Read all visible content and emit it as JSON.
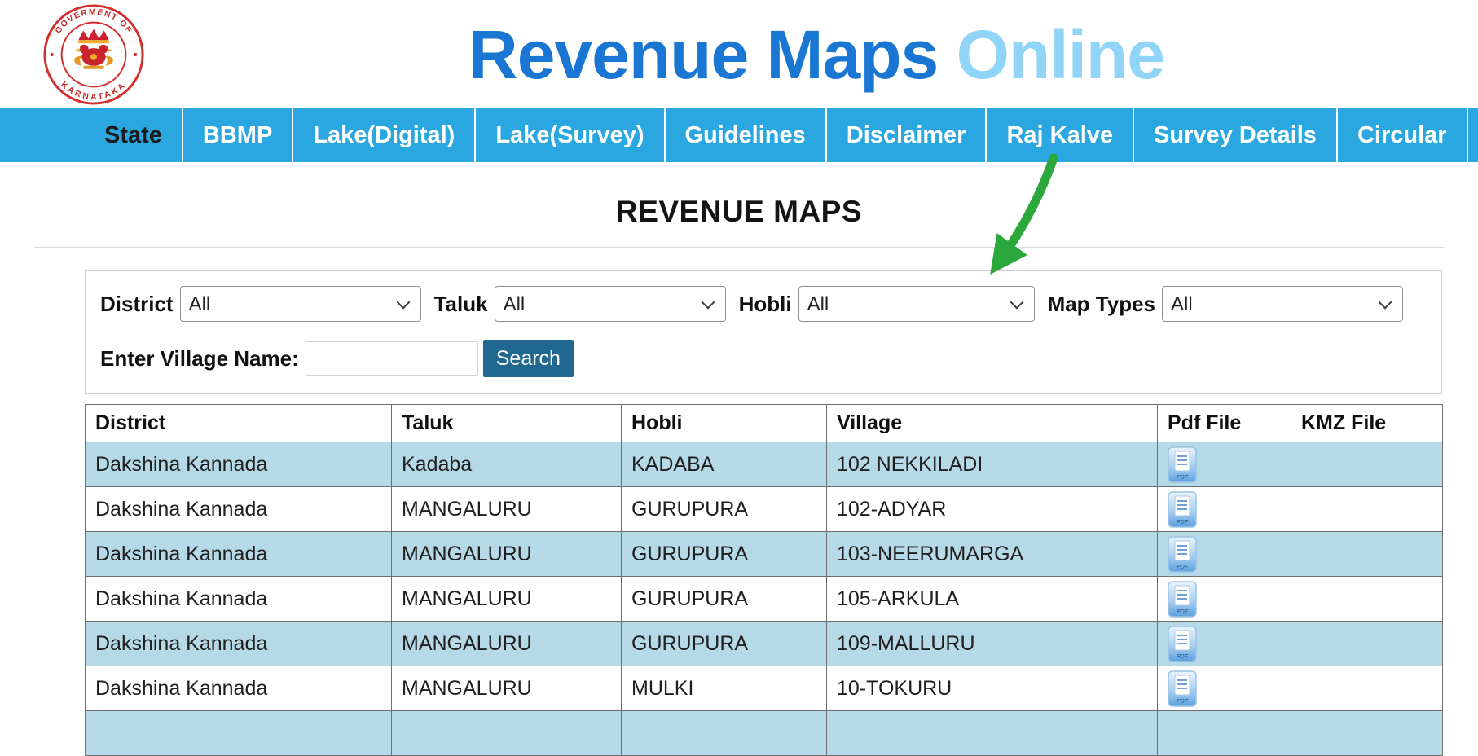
{
  "colors": {
    "nav_bg": "#2aa7e0",
    "title_primary": "#1976d2",
    "title_secondary": "#90d5f7",
    "row_stripe": "#b6d9e7",
    "search_button": "#20688f",
    "annotation_arrow": "#2ba83c"
  },
  "logo": {
    "top_text": "GOVERMENT OF",
    "bottom_text": "KARNATAKA"
  },
  "header": {
    "title_primary": "Revenue Maps",
    "title_secondary": "Online"
  },
  "nav": {
    "items": [
      {
        "label": "State",
        "active": true
      },
      {
        "label": "BBMP"
      },
      {
        "label": "Lake(Digital)"
      },
      {
        "label": "Lake(Survey)"
      },
      {
        "label": "Guidelines"
      },
      {
        "label": "Disclaimer"
      },
      {
        "label": "Raj Kalve"
      },
      {
        "label": "Survey Details"
      },
      {
        "label": "Circular"
      }
    ]
  },
  "page": {
    "heading": "REVENUE MAPS"
  },
  "filters": {
    "district_label": "District",
    "district_value": "All",
    "taluk_label": "Taluk",
    "taluk_value": "All",
    "hobli_label": "Hobli",
    "hobli_value": "All",
    "map_types_label": "Map Types",
    "map_types_value": "All",
    "village_label": "Enter Village Name:",
    "village_value": "",
    "search_label": "Search"
  },
  "table": {
    "columns": [
      "District",
      "Taluk",
      "Hobli",
      "Village",
      "Pdf File",
      "KMZ File"
    ],
    "rows": [
      {
        "district": "Dakshina Kannada",
        "taluk": "Kadaba",
        "hobli": "KADABA",
        "village": "102 NEKKILADI",
        "pdf": true,
        "kmz": ""
      },
      {
        "district": "Dakshina Kannada",
        "taluk": "MANGALURU",
        "hobli": "GURUPURA",
        "village": "102-ADYAR",
        "pdf": true,
        "kmz": ""
      },
      {
        "district": "Dakshina Kannada",
        "taluk": "MANGALURU",
        "hobli": "GURUPURA",
        "village": "103-NEERUMARGA",
        "pdf": true,
        "kmz": ""
      },
      {
        "district": "Dakshina Kannada",
        "taluk": "MANGALURU",
        "hobli": "GURUPURA",
        "village": "105-ARKULA",
        "pdf": true,
        "kmz": ""
      },
      {
        "district": "Dakshina Kannada",
        "taluk": "MANGALURU",
        "hobli": "GURUPURA",
        "village": "109-MALLURU",
        "pdf": true,
        "kmz": ""
      },
      {
        "district": "Dakshina Kannada",
        "taluk": "MANGALURU",
        "hobli": "MULKI",
        "village": "10-TOKURU",
        "pdf": true,
        "kmz": ""
      }
    ]
  }
}
